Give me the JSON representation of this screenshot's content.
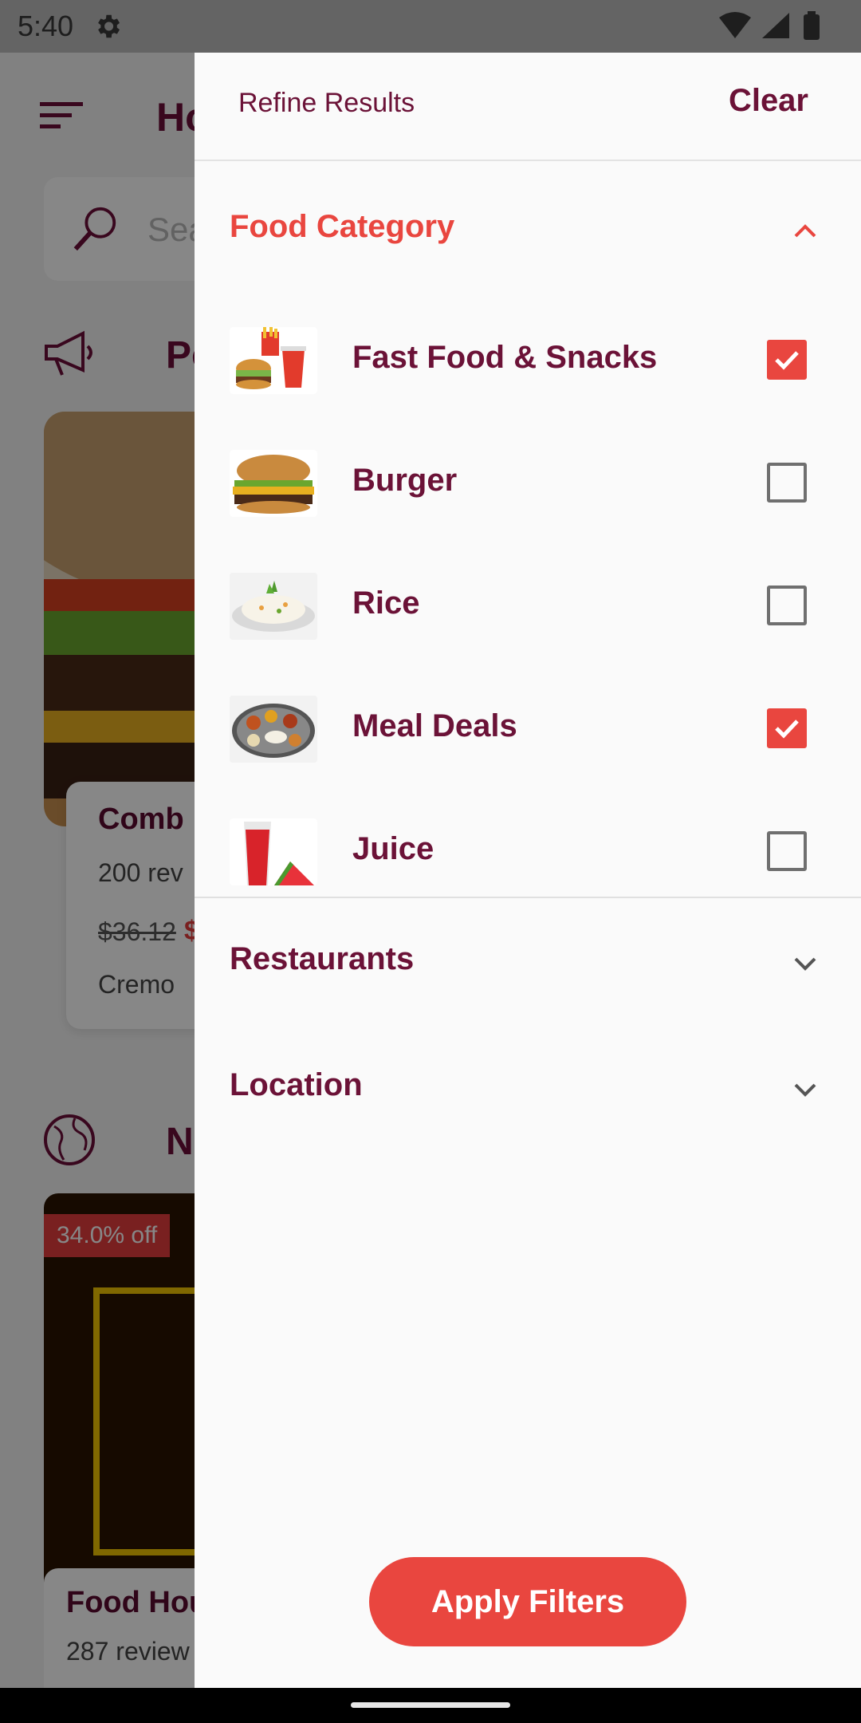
{
  "status_bar": {
    "time": "5:40"
  },
  "background": {
    "title": "Ho",
    "search_placeholder": "Sea",
    "section1": "Po",
    "card": {
      "title": "Comb",
      "reviews": "200 rev",
      "old_price": "$36.12",
      "new_price": "$",
      "subtitle": "Cremo"
    },
    "section2": "N",
    "promo_badge": "34.0% off",
    "card2": {
      "title": "Food Hou",
      "reviews": "287 review"
    }
  },
  "drawer": {
    "title": "Refine Results",
    "clear_label": "Clear",
    "food_category": {
      "label": "Food Category",
      "items": [
        {
          "label": "Fast Food & Snacks",
          "checked": true
        },
        {
          "label": "Burger",
          "checked": false
        },
        {
          "label": "Rice",
          "checked": false
        },
        {
          "label": "Meal Deals",
          "checked": true
        },
        {
          "label": "Juice",
          "checked": false
        }
      ]
    },
    "restaurants_label": "Restaurants",
    "location_label": "Location",
    "apply_label": "Apply Filters"
  },
  "colors": {
    "accent": "#e9463f",
    "brand": "#6b1237"
  }
}
